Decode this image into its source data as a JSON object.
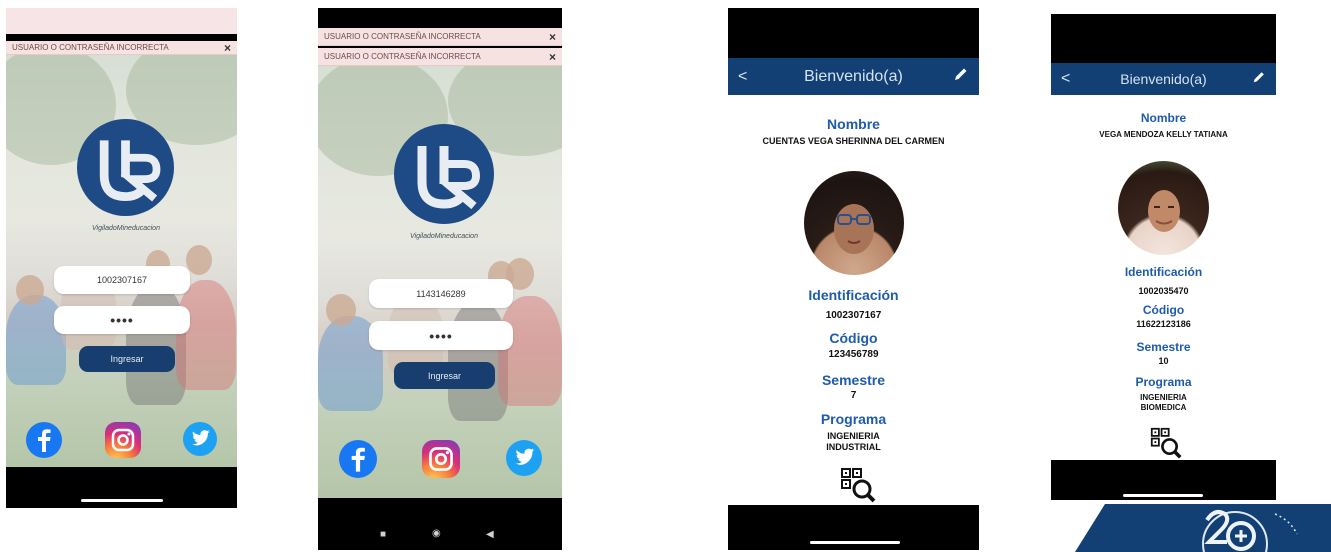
{
  "login_a": {
    "error": "USUARIO O CONTRASEÑA INCORRECTA",
    "close": "×",
    "motto": "VigiladoMineducacion",
    "user_value": "1002307167",
    "password_value": "••••",
    "button": "Ingresar"
  },
  "login_b": {
    "errors": [
      "USUARIO O CONTRASEÑA INCORRECTA",
      "USUARIO O CONTRASEÑA INCORRECTA"
    ],
    "close": "×",
    "motto": "VigiladoMineducacion",
    "user_value": "1143146289",
    "password_value": "••••",
    "button": "Ingresar",
    "nav": [
      "■",
      "◉",
      "◀"
    ]
  },
  "profile_a": {
    "title": "Bienvenido(a)",
    "back": "<",
    "name_label": "Nombre",
    "name": "CUENTAS VEGA SHERINNA DEL CARMEN",
    "id_label": "Identificación",
    "id": "1002307167",
    "code_label": "Código",
    "code": "123456789",
    "semester_label": "Semestre",
    "semester": "7",
    "program_label": "Programa",
    "program_line1": "INGENIERIA",
    "program_line2": "INDUSTRIAL"
  },
  "profile_b": {
    "title": "Bienvenido(a)",
    "back": "<",
    "name_label": "Nombre",
    "name": "VEGA MENDOZA KELLY TATIANA",
    "id_label": "Identificación",
    "id": "1002035470",
    "code_label": "Código",
    "code": "11622123186",
    "semester_label": "Semestre",
    "semester": "10",
    "program_label": "Programa",
    "program_line1": "INGENIERIA",
    "program_line2": "BIOMEDICA"
  },
  "colors": {
    "brand_blue": "#123f74",
    "label_blue": "#1f5bac",
    "error_bg": "#f7e2e2"
  },
  "icons": [
    "facebook-icon",
    "instagram-icon",
    "twitter-icon",
    "back-arrow-icon",
    "edit-pencil-icon",
    "qr-search-icon"
  ]
}
